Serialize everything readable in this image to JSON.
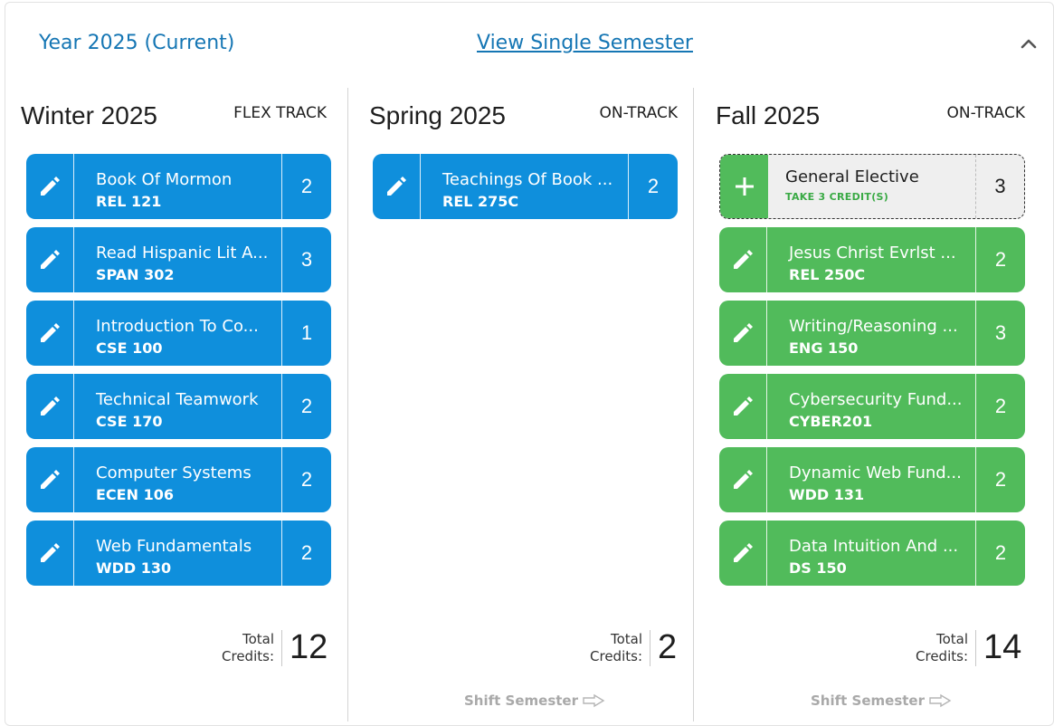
{
  "header": {
    "year_title": "Year 2025 (Current)",
    "view_link": "View Single Semester",
    "collapse_icon": "chevron-up-icon"
  },
  "colors": {
    "link": "#1576b4",
    "blue_course": "#0f8fdc",
    "green_course": "#51bb5b",
    "elective_bg": "#efefef"
  },
  "semesters": [
    {
      "name": "Winter 2025",
      "track": "FLEX TRACK",
      "courses": [
        {
          "name": "Book Of Mormon",
          "code": "REL 121",
          "credits": "2",
          "icon": "pencil-icon"
        },
        {
          "name": "Read Hispanic Lit A...",
          "code": "SPAN 302",
          "credits": "3",
          "icon": "pencil-icon"
        },
        {
          "name": "Introduction To Co...",
          "code": "CSE 100",
          "credits": "1",
          "icon": "pencil-icon"
        },
        {
          "name": "Technical Teamwork",
          "code": "CSE 170",
          "credits": "2",
          "icon": "pencil-icon"
        },
        {
          "name": "Computer Systems",
          "code": "ECEN 106",
          "credits": "2",
          "icon": "pencil-icon"
        },
        {
          "name": "Web Fundamentals",
          "code": "WDD 130",
          "credits": "2",
          "icon": "pencil-icon"
        }
      ],
      "total_label": "Total Credits:",
      "total_value": "12"
    },
    {
      "name": "Spring 2025",
      "track": "ON-TRACK",
      "courses": [
        {
          "name": "Teachings Of Book ...",
          "code": "REL 275C",
          "credits": "2",
          "icon": "pencil-icon"
        }
      ],
      "total_label": "Total Credits:",
      "total_value": "2",
      "shift_label": "Shift Semester"
    },
    {
      "name": "Fall 2025",
      "track": "ON-TRACK",
      "elective": {
        "name": "General Elective",
        "sub": "TAKE 3 CREDIT(S)",
        "credits": "3",
        "icon": "plus-icon"
      },
      "courses": [
        {
          "name": "Jesus Christ Evrlst ...",
          "code": "REL 250C",
          "credits": "2",
          "icon": "pencil-icon"
        },
        {
          "name": "Writing/Reasoning ...",
          "code": "ENG 150",
          "credits": "3",
          "icon": "pencil-icon"
        },
        {
          "name": "Cybersecurity Fund...",
          "code": "CYBER201",
          "credits": "2",
          "icon": "pencil-icon"
        },
        {
          "name": "Dynamic Web Fund...",
          "code": "WDD 131",
          "credits": "2",
          "icon": "pencil-icon"
        },
        {
          "name": "Data Intuition And ...",
          "code": "DS 150",
          "credits": "2",
          "icon": "pencil-icon"
        }
      ],
      "total_label": "Total Credits:",
      "total_value": "14",
      "shift_label": "Shift Semester"
    }
  ]
}
